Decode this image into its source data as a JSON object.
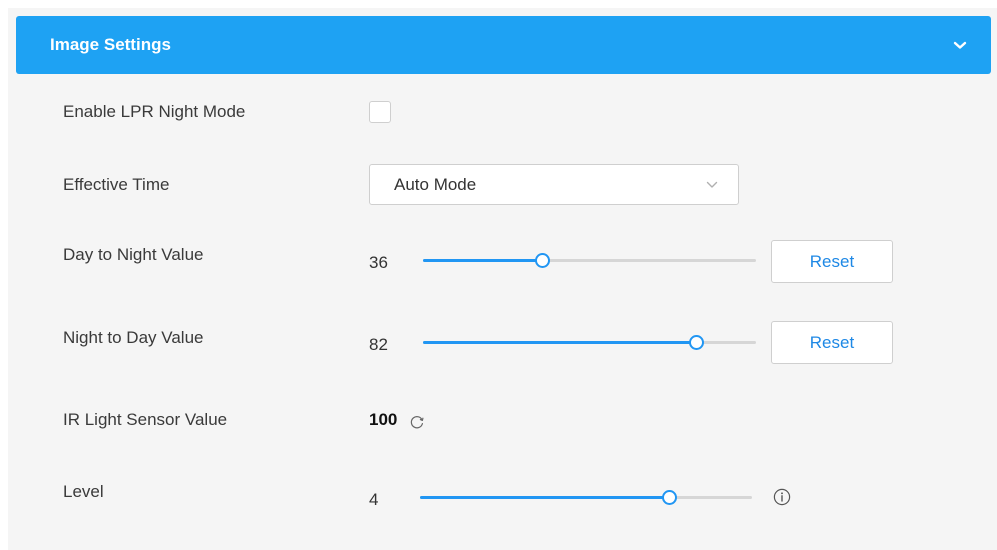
{
  "header": {
    "title": "Image Settings"
  },
  "rows": {
    "lpr_night_mode": {
      "label": "Enable LPR Night Mode",
      "checked": false
    },
    "effective_time": {
      "label": "Effective Time",
      "selected": "Auto Mode"
    },
    "day_to_night": {
      "label": "Day to Night Value",
      "value": "36",
      "reset_label": "Reset",
      "fraction": 0.36
    },
    "night_to_day": {
      "label": "Night to Day Value",
      "value": "82",
      "reset_label": "Reset",
      "fraction": 0.82
    },
    "ir_light_sensor": {
      "label": "IR Light Sensor Value",
      "value": "100"
    },
    "level": {
      "label": "Level",
      "value": "4",
      "fraction": 0.75
    }
  },
  "colors": {
    "accent": "#1ea2f3",
    "slider": "#2196f3",
    "button_text": "#1e88e5"
  }
}
